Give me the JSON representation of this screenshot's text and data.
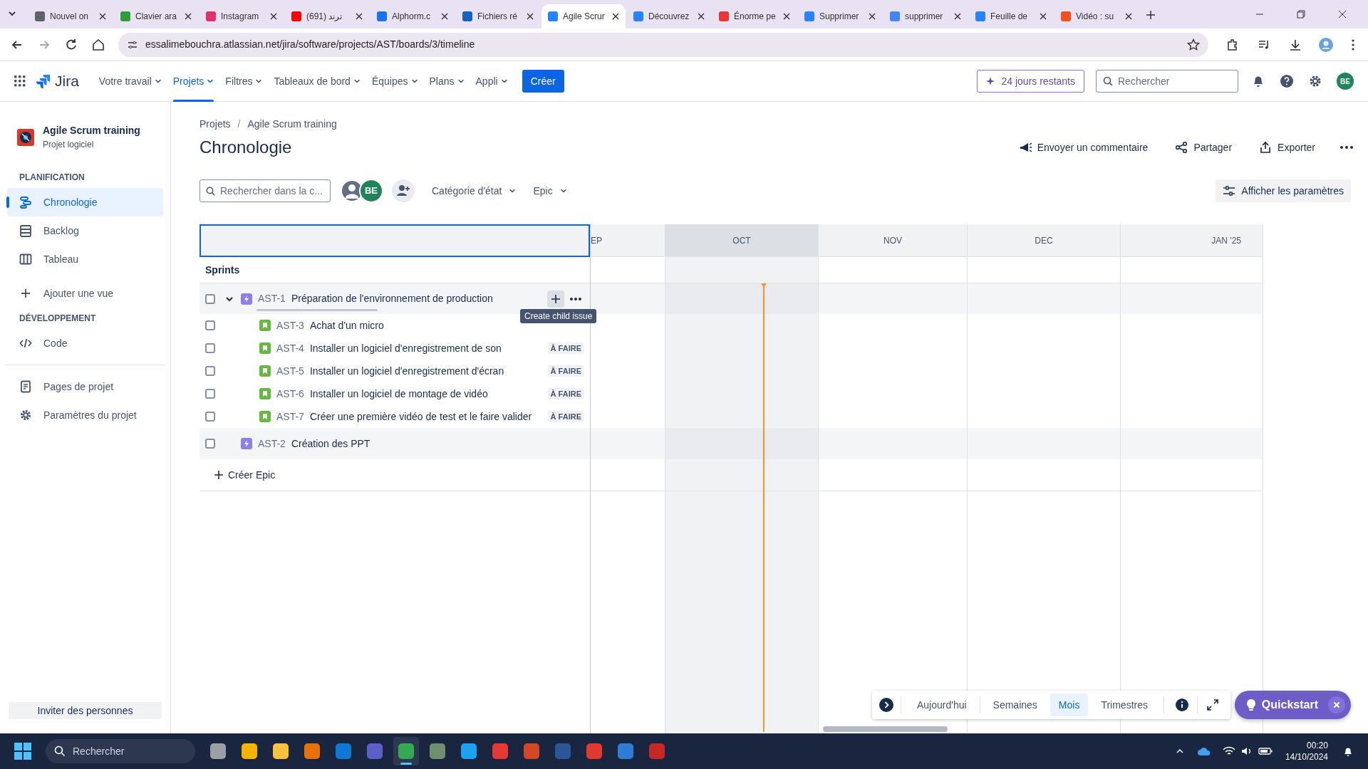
{
  "browser": {
    "tabs": [
      {
        "title": "Nouvel on",
        "color": "#5f6368",
        "selected": false
      },
      {
        "title": "Clavier ara",
        "color": "#2e9d3a",
        "selected": false
      },
      {
        "title": "Instagram",
        "color": "#e1306c",
        "selected": false
      },
      {
        "title": "ترند (691)",
        "color": "#ff0000",
        "selected": false
      },
      {
        "title": "Alphorm.c",
        "color": "#1a73e8",
        "selected": false
      },
      {
        "title": "Fichiers ré",
        "color": "#1565c0",
        "selected": false
      },
      {
        "title": "Agile Scrur",
        "color": "#2684ff",
        "selected": true
      },
      {
        "title": "Découvrez",
        "color": "#2684ff",
        "selected": false
      },
      {
        "title": "Énorme pe",
        "color": "#e53935",
        "selected": false
      },
      {
        "title": "Supprimer",
        "color": "#2684ff",
        "selected": false
      },
      {
        "title": "supprimer",
        "color": "#4285f4",
        "selected": false
      },
      {
        "title": "Feuille de",
        "color": "#2684ff",
        "selected": false
      },
      {
        "title": "Vidéo : su",
        "color": "#f25022",
        "selected": false
      }
    ],
    "url": "essalimebouchra.atlassian.net/jira/software/projects/AST/boards/3/timeline"
  },
  "topnav": {
    "product": "Jira",
    "items": [
      {
        "label": "Votre travail",
        "selected": false
      },
      {
        "label": "Projets",
        "selected": true
      },
      {
        "label": "Filtres",
        "selected": false
      },
      {
        "label": "Tableaux de bord",
        "selected": false
      },
      {
        "label": "Équipes",
        "selected": false
      },
      {
        "label": "Plans",
        "selected": false
      },
      {
        "label": "Appli",
        "selected": false
      }
    ],
    "create": "Créer",
    "trial": "24 jours restants",
    "search_placeholder": "Rechercher",
    "avatar": "BE"
  },
  "sidebar": {
    "project": "Agile Scrum training",
    "project_type": "Projet logiciel",
    "sections": [
      {
        "heading": "PLANIFICATION",
        "items": [
          {
            "label": "Chronologie",
            "selected": true
          },
          {
            "label": "Backlog",
            "selected": false
          },
          {
            "label": "Tableau",
            "selected": false
          }
        ]
      },
      {
        "items": [
          {
            "label": "Ajouter une vue",
            "selected": false
          }
        ]
      },
      {
        "heading": "DÉVELOPPEMENT",
        "items": [
          {
            "label": "Code",
            "selected": false
          }
        ]
      },
      {
        "items": [
          {
            "label": "Pages de projet",
            "selected": false
          },
          {
            "label": "Paramètres du projet",
            "selected": false
          }
        ]
      }
    ],
    "invite": "Inviter des personnes"
  },
  "page": {
    "breadcrumbs": [
      "Projets",
      "Agile Scrum training"
    ],
    "breadcrumb_separator": "/",
    "title": "Chronologie",
    "actions": [
      "Envoyer un commentaire",
      "Partager",
      "Exporter"
    ],
    "search_placeholder": "Rechercher dans la c...",
    "avatar": "BE",
    "filters": [
      "Catégorie d'état",
      "Epic"
    ],
    "settings": "Afficher les paramètres"
  },
  "timeline": {
    "months": [
      {
        "label": "EP",
        "shaded": false
      },
      {
        "label": "OCT",
        "shaded": true
      },
      {
        "label": "NOV",
        "shaded": false
      },
      {
        "label": "DEC",
        "shaded": false
      },
      {
        "label": "JAN '25",
        "shaded": false
      }
    ],
    "sprints_label": "Sprints",
    "issues": [
      {
        "key": "AST-1",
        "title": "Préparation de l'environnement de production",
        "kind": "epic",
        "checked": false,
        "expanded": true,
        "level": 0,
        "children": [
          {
            "key": "AST-3",
            "title": "Achat d'un micro",
            "kind": "story",
            "checked": false
          },
          {
            "key": "AST-4",
            "title": "Installer un logiciel d'enregistrement de son",
            "kind": "story",
            "checked": false,
            "status": "À FAIRE"
          },
          {
            "key": "AST-5",
            "title": "Installer un logiciel d'enregistrement d'écran",
            "kind": "story",
            "checked": false,
            "status": "À FAIRE"
          },
          {
            "key": "AST-6",
            "title": "Installer un logiciel de montage de vidéo",
            "kind": "story",
            "checked": false,
            "status": "À FAIRE"
          },
          {
            "key": "AST-7",
            "title": "Créer une première vidéo de test et le faire valider",
            "kind": "story",
            "checked": false,
            "status": "À FAIRE"
          }
        ]
      },
      {
        "key": "AST-2",
        "title": "Création des PPT",
        "kind": "epic",
        "checked": false
      }
    ],
    "tooltip": "Create child issue",
    "create_epic": "Créer Epic",
    "views": [
      {
        "label": "Aujourd'hui",
        "selected": false
      },
      {
        "label": "Semaines",
        "selected": false
      },
      {
        "label": "Mois",
        "selected": true
      },
      {
        "label": "Trimestres",
        "selected": false
      }
    ]
  },
  "quickstart": "Quickstart",
  "taskbar": {
    "search_placeholder": "Rechercher",
    "apps": [
      {
        "color": "#9aa0a6",
        "selected": false
      },
      {
        "color": "#f4b400",
        "selected": false
      },
      {
        "color": "#f9c23c",
        "selected": false
      },
      {
        "color": "#e8710a",
        "selected": false
      },
      {
        "color": "#0f78d4",
        "selected": false
      },
      {
        "color": "#5b5fc7",
        "selected": false
      },
      {
        "color": "#34a853",
        "selected": true
      },
      {
        "color": "#6f8f6f",
        "selected": false
      },
      {
        "color": "#1da1f2",
        "selected": false
      },
      {
        "color": "#e53935",
        "selected": false
      },
      {
        "color": "#d24726",
        "selected": false
      },
      {
        "color": "#2b579a",
        "selected": false
      },
      {
        "color": "#e03a2f",
        "selected": false
      },
      {
        "color": "#2d7dd2",
        "selected": false
      },
      {
        "color": "#c62828",
        "selected": false
      }
    ],
    "time": "00:20",
    "date": "14/10/2024"
  }
}
